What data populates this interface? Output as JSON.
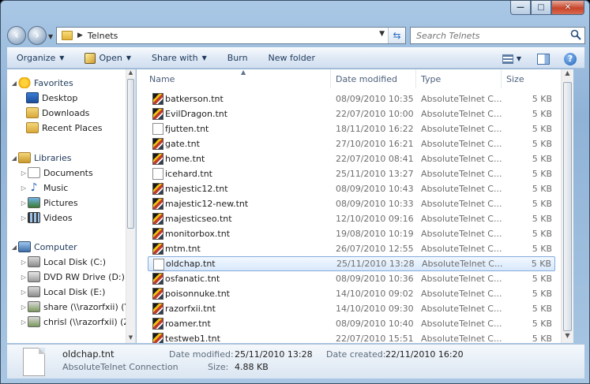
{
  "window": {
    "caption_minimize": "—",
    "caption_maximize": "□",
    "caption_close": "✕"
  },
  "address": {
    "path": "Telnets",
    "search_placeholder": "Search Telnets"
  },
  "toolbar": {
    "organize": "Organize",
    "open": "Open",
    "share_with": "Share with",
    "burn": "Burn",
    "new_folder": "New folder",
    "help": "?"
  },
  "nav": {
    "favorites": "Favorites",
    "desktop": "Desktop",
    "downloads": "Downloads",
    "recent": "Recent Places",
    "libraries": "Libraries",
    "documents": "Documents",
    "music": "Music",
    "pictures": "Pictures",
    "videos": "Videos",
    "computer": "Computer",
    "local_c": "Local Disk (C:)",
    "dvd": "DVD RW Drive (D:) Th",
    "local_e": "Local Disk (E:)",
    "share_y": "share (\\\\razorfxii) (Y:)",
    "chrisl_z": "chrisl (\\\\razorfxii) (Z:)"
  },
  "columns": {
    "name": "Name",
    "date": "Date modified",
    "type": "Type",
    "size": "Size"
  },
  "files": [
    {
      "name": "batkerson.tnt",
      "date": "08/09/2010 10:35",
      "type": "AbsoluteTelnet C...",
      "size": "5 KB",
      "icon": "tnt"
    },
    {
      "name": "EvilDragon.tnt",
      "date": "22/07/2010 10:00",
      "type": "AbsoluteTelnet C...",
      "size": "5 KB",
      "icon": "tnt"
    },
    {
      "name": "fjutten.tnt",
      "date": "18/11/2010 16:22",
      "type": "AbsoluteTelnet C...",
      "size": "5 KB",
      "icon": "doc"
    },
    {
      "name": "gate.tnt",
      "date": "27/10/2010 16:21",
      "type": "AbsoluteTelnet C...",
      "size": "5 KB",
      "icon": "tnt"
    },
    {
      "name": "home.tnt",
      "date": "22/07/2010 08:41",
      "type": "AbsoluteTelnet C...",
      "size": "5 KB",
      "icon": "tnt"
    },
    {
      "name": "icehard.tnt",
      "date": "25/11/2010 13:27",
      "type": "AbsoluteTelnet C...",
      "size": "5 KB",
      "icon": "doc"
    },
    {
      "name": "majestic12.tnt",
      "date": "08/09/2010 10:43",
      "type": "AbsoluteTelnet C...",
      "size": "5 KB",
      "icon": "tnt"
    },
    {
      "name": "majestic12-new.tnt",
      "date": "08/09/2010 10:33",
      "type": "AbsoluteTelnet C...",
      "size": "5 KB",
      "icon": "tnt"
    },
    {
      "name": "majesticseo.tnt",
      "date": "12/10/2010 09:16",
      "type": "AbsoluteTelnet C...",
      "size": "5 KB",
      "icon": "tnt"
    },
    {
      "name": "monitorbox.tnt",
      "date": "19/08/2010 10:19",
      "type": "AbsoluteTelnet C...",
      "size": "5 KB",
      "icon": "tnt"
    },
    {
      "name": "mtm.tnt",
      "date": "26/07/2010 12:55",
      "type": "AbsoluteTelnet C...",
      "size": "5 KB",
      "icon": "tnt"
    },
    {
      "name": "oldchap.tnt",
      "date": "25/11/2010 13:28",
      "type": "AbsoluteTelnet C...",
      "size": "5 KB",
      "icon": "doc",
      "selected": true
    },
    {
      "name": "osfanatic.tnt",
      "date": "08/09/2010 10:36",
      "type": "AbsoluteTelnet C...",
      "size": "5 KB",
      "icon": "tnt"
    },
    {
      "name": "poisonnuke.tnt",
      "date": "14/10/2010 09:02",
      "type": "AbsoluteTelnet C...",
      "size": "5 KB",
      "icon": "tnt"
    },
    {
      "name": "razorfxii.tnt",
      "date": "14/10/2010 09:30",
      "type": "AbsoluteTelnet C...",
      "size": "5 KB",
      "icon": "tnt"
    },
    {
      "name": "roamer.tnt",
      "date": "08/09/2010 10:40",
      "type": "AbsoluteTelnet C...",
      "size": "5 KB",
      "icon": "tnt"
    },
    {
      "name": "testweb1.tnt",
      "date": "22/07/2010 15:51",
      "type": "AbsoluteTelnet C...",
      "size": "5 KB",
      "icon": "tnt"
    }
  ],
  "details": {
    "name": "oldchap.tnt",
    "type": "AbsoluteTelnet Connection",
    "modified_label": "Date modified:",
    "modified": "25/11/2010 13:28",
    "created_label": "Date created:",
    "created": "22/11/2010 16:20",
    "size_label": "Size:",
    "size": "4.88 KB"
  }
}
